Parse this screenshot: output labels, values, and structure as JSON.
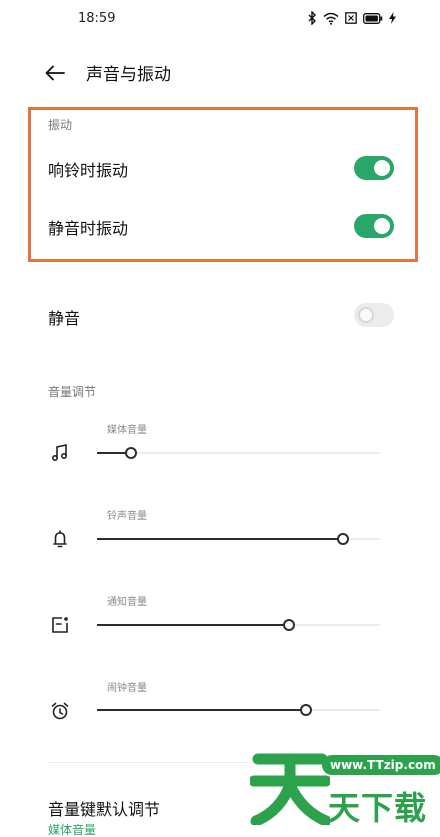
{
  "status_bar": {
    "time": "18:59"
  },
  "header": {
    "title": "声音与振动",
    "back_icon": "arrow-left-icon"
  },
  "vibration": {
    "section_label": "振动",
    "items": [
      {
        "label": "响铃时振动",
        "on": true
      },
      {
        "label": "静音时振动",
        "on": true
      }
    ]
  },
  "mute": {
    "label": "静音",
    "on": false
  },
  "volume": {
    "section_label": "音量调节",
    "items": [
      {
        "label": "媒体音量",
        "icon": "music-note-icon",
        "level": 0.12
      },
      {
        "label": "铃声音量",
        "icon": "bell-icon",
        "level": 0.87
      },
      {
        "label": "通知音量",
        "icon": "notification-icon",
        "level": 0.68
      },
      {
        "label": "闹钟音量",
        "icon": "alarm-clock-icon",
        "level": 0.74
      }
    ]
  },
  "volume_key": {
    "title": "音量键默认调节",
    "value": "媒体音量"
  },
  "watermark": {
    "url": "www.TTzip.com",
    "name": "天下载"
  },
  "colors": {
    "accent": "#29a668",
    "highlight_border": "#e2753f",
    "watermark_green": "#2da24c"
  }
}
